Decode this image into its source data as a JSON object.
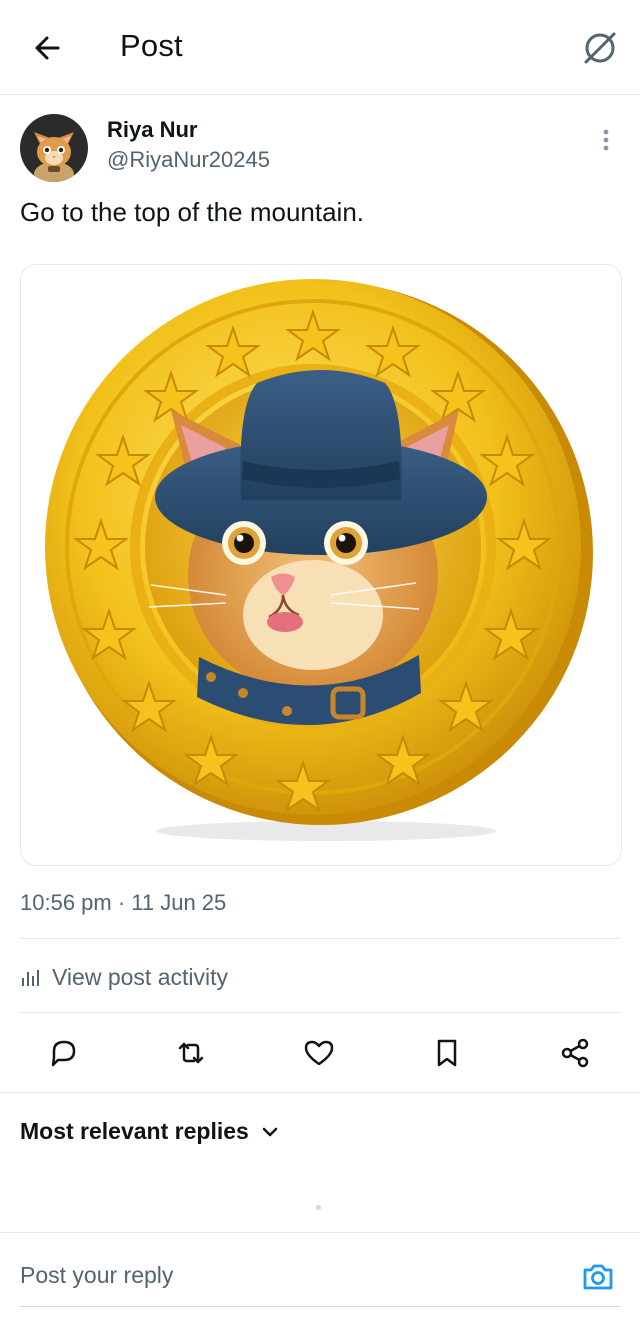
{
  "header": {
    "title": "Post",
    "back_icon": "arrow-left-icon",
    "grok_icon": "grok-slash-circle-icon"
  },
  "post": {
    "author_name": "Riya Nur",
    "author_handle": "@RiyaNur20245",
    "text": "Go to the top of the mountain.",
    "timestamp": "10:56 pm · 11 Jun 25",
    "activity_label": "View post activity",
    "image_subject": "gold coin with cat wearing blue hat and collar"
  },
  "actions": [
    "reply-icon",
    "repost-icon",
    "like-icon",
    "bookmark-icon",
    "share-icon"
  ],
  "replies": {
    "sort_label": "Most relevant replies"
  },
  "reply_bar": {
    "placeholder": "Post your reply",
    "camera_icon": "camera-icon"
  },
  "colors": {
    "text_primary": "#0f1419",
    "text_secondary": "#536471",
    "divider": "#e6e9ec",
    "accent": "#1d9bf0",
    "coin_gold": "#f2c11a"
  }
}
